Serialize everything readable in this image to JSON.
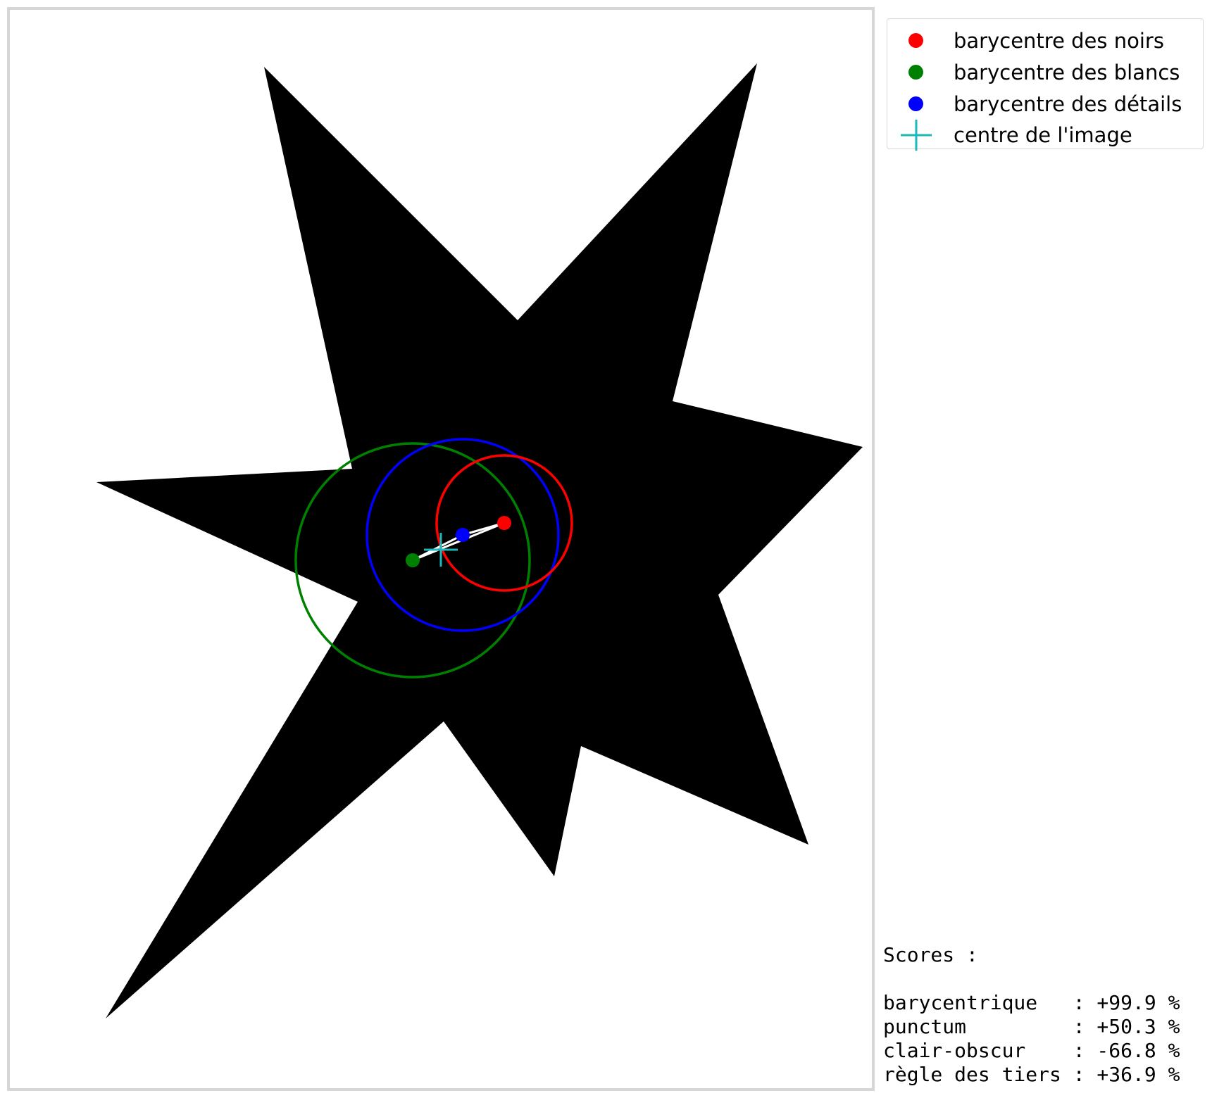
{
  "colors": {
    "noirs": "#ff0000",
    "blancs": "#008000",
    "details": "#0000ff",
    "centre": "#1ab8b8",
    "shape": "#000000",
    "link": "#ffffff"
  },
  "legend": {
    "items": [
      {
        "label": "barycentre des noirs",
        "marker": "dot",
        "color": "#ff0000"
      },
      {
        "label": "barycentre des blancs",
        "marker": "dot",
        "color": "#008000"
      },
      {
        "label": "barycentre des détails",
        "marker": "dot",
        "color": "#0000ff"
      },
      {
        "label": "centre de l'image",
        "marker": "plus-icon",
        "color": "#1ab8b8"
      }
    ]
  },
  "scores": {
    "title": "Scores :",
    "rows": [
      {
        "text": "barycentrique   : +99.9 %"
      },
      {
        "text": "punctum         : +50.3 %"
      },
      {
        "text": "clair-obscur    : -66.8 %"
      },
      {
        "text": "règle des tiers : +36.9 %"
      }
    ]
  }
}
